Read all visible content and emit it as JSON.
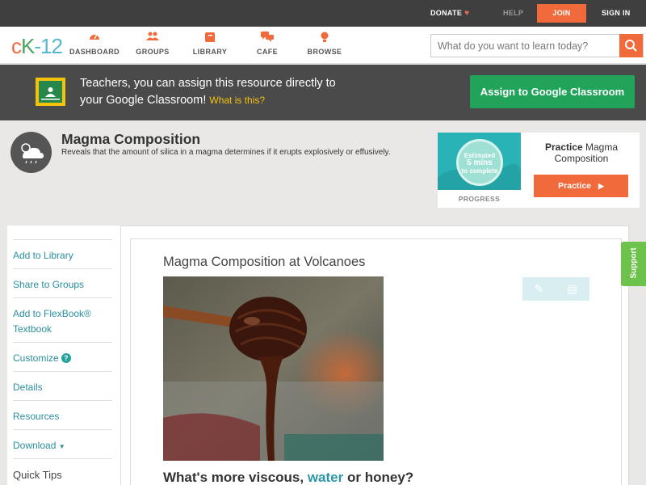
{
  "topbar": {
    "donate": "DONATE",
    "help": "HELP",
    "join": "JOIN",
    "sign_in": "SIGN IN"
  },
  "nav": {
    "logo_c": "c",
    "logo_k": "K",
    "logo_n": "-12",
    "items": [
      {
        "label": "DASHBOARD",
        "icon": "dashboard-icon"
      },
      {
        "label": "GROUPS",
        "icon": "groups-icon"
      },
      {
        "label": "LIBRARY",
        "icon": "library-icon"
      },
      {
        "label": "CAFE",
        "icon": "cafe-icon"
      },
      {
        "label": "BROWSE",
        "icon": "browse-icon"
      }
    ],
    "search_placeholder": "What do you want to learn today?"
  },
  "banner": {
    "line1": "Teachers, you can assign this resource directly to",
    "line2": "your Google Classroom!",
    "link": "What is this?",
    "button": "Assign to Google Classroom"
  },
  "resource": {
    "title": "Magma Composition",
    "description": "Reveals that the amount of silica in a magma determines if it erupts explosively or effusively."
  },
  "practice": {
    "estimated": "Estimated",
    "mins": "5 mins",
    "to_complete": "to complete",
    "progress_label": "PROGRESS",
    "heading_bold": "Practice",
    "heading_rest": "Magma Composition",
    "button": "Practice"
  },
  "sidebar": {
    "add_library": "Add to Library",
    "share_groups": "Share to Groups",
    "add_flexbook": "Add to FlexBook®",
    "flexbook_textbook": "Textbook",
    "customize": "Customize",
    "details": "Details",
    "resources": "Resources",
    "download": "Download",
    "quick_tips": "Quick Tips"
  },
  "article": {
    "title": "Magma Composition at Volcanoes",
    "question_pre": "What's more viscous,",
    "question_water": "water",
    "question_post": "or honey?"
  },
  "support": "Support",
  "colors": {
    "brand_orange": "#f16a3b",
    "brand_green": "#22a35a",
    "link_teal": "#2a8f9e",
    "google_yellow": "#f4c20d"
  }
}
